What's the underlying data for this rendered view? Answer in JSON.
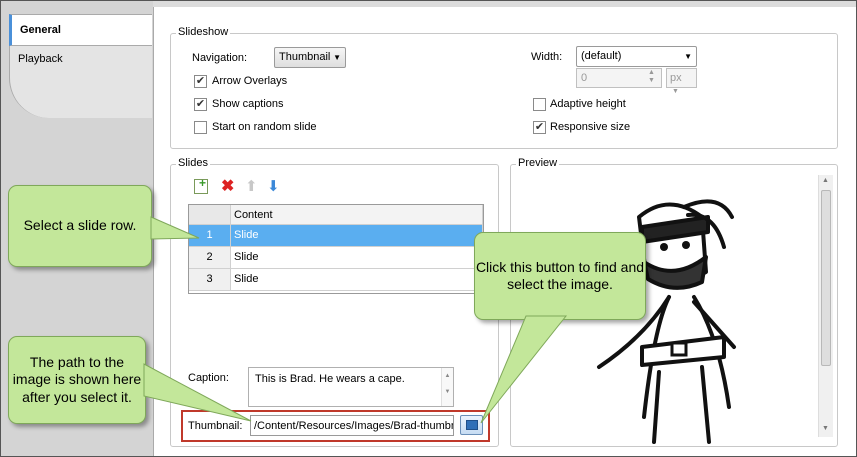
{
  "tabs": {
    "general": "General",
    "playback": "Playback"
  },
  "slideshow": {
    "legend": "Slideshow",
    "navigation_label": "Navigation:",
    "navigation_value": "Thumbnail",
    "arrow_overlays": {
      "label": "Arrow Overlays",
      "checked": true
    },
    "show_captions": {
      "label": "Show captions",
      "checked": true
    },
    "random_slide": {
      "label": "Start on random slide",
      "checked": false
    },
    "width_label": "Width:",
    "width_value": "(default)",
    "width_number": "0",
    "width_unit": "px",
    "adaptive_height": {
      "label": "Adaptive height",
      "checked": false
    },
    "responsive_size": {
      "label": "Responsive size",
      "checked": true
    }
  },
  "slides": {
    "legend": "Slides",
    "column_header": "Content",
    "rows": [
      {
        "num": "1",
        "content": "Slide",
        "selected": true
      },
      {
        "num": "2",
        "content": "Slide",
        "selected": false
      },
      {
        "num": "3",
        "content": "Slide",
        "selected": false
      }
    ],
    "caption_label": "Caption:",
    "caption_value": "This is Brad. He wears a cape.",
    "thumbnail_label": "Thumbnail:",
    "thumbnail_value": "/Content/Resources/Images/Brad-thumbn"
  },
  "preview": {
    "legend": "Preview"
  },
  "callouts": {
    "select_row": "Select a slide row.",
    "click_button": "Click this button to find and select the image.",
    "path": "The path to the image is shown here after you select it."
  },
  "colors": {
    "selection": "#5aaef0",
    "callout_fill": "#c3e79a",
    "highlight_border": "#c0392b"
  }
}
